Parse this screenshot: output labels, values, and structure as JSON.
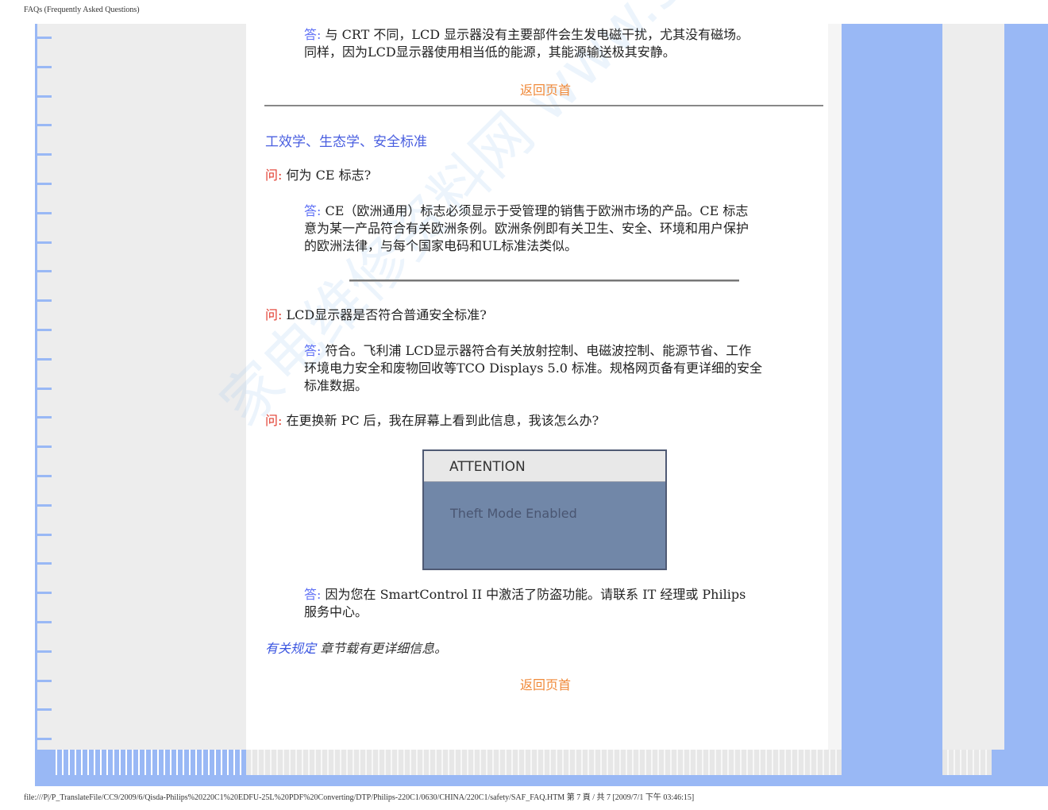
{
  "header": {
    "title": "FAQs (Frequently Asked Questions)"
  },
  "footer": {
    "path": "file:///P|/P_TranslateFile/CC9/2009/6/Qisda-Philips%20220C1%20EDFU-25L%20PDF%20Converting/DTP/Philips-220C1/0630/CHINA/220C1/safety/SAF_FAQ.HTM 第 7 頁 / 共 7  [2009/7/1 下午 03:46:15]"
  },
  "watermark": "家电维修资料网 www.520101.com",
  "answer_label": "答:",
  "question_label": "问:",
  "back_to_top": "返回页首",
  "block0": {
    "line1": "与 CRT 不同，LCD 显示器没有主要部件会生发电磁干扰，尤其没有磁场。",
    "line2": "同样，因为LCD显示器使用相当低的能源，其能源输送极其安静。"
  },
  "section": {
    "title": "工效学、生态学、安全标准"
  },
  "q1": {
    "question": "何为 CE 标志?",
    "line1": "CE（欧洲通用）标志必须显示于受管理的销售于欧洲市场的产品。CE 标志",
    "line2": "意为某一产品符合有关欧洲条例。欧洲条例即有关卫生、安全、环境和用户保护",
    "line3": "的欧洲法律，与每个国家电码和UL标准法类似。"
  },
  "q2": {
    "question": "LCD显示器是否符合普通安全标准?",
    "line1": "符合。飞利浦 LCD显示器符合有关放射控制、电磁波控制、能源节省、工作",
    "line2": "环境电力安全和废物回收等TCO Displays 5.0 标准。规格网页备有更详细的安全",
    "line3": "标准数据。"
  },
  "q3": {
    "question": "在更换新 PC 后，我在屏幕上看到此信息，我该怎么办?",
    "dialog_title": "ATTENTION",
    "dialog_message": "Theft Mode Enabled",
    "line1": "因为您在 SmartControl II 中激活了防盗功能。请联系 IT 经理或 Philips",
    "line2": "服务中心。"
  },
  "more_info": {
    "link": "有关规定",
    "text": " 章节载有更详细信息。"
  }
}
